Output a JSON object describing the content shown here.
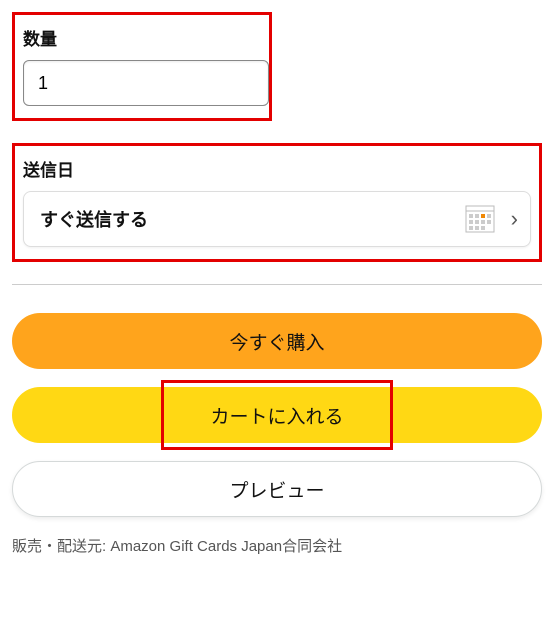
{
  "quantity": {
    "label": "数量",
    "value": "1"
  },
  "sendDate": {
    "label": "送信日",
    "option": "すぐ送信する"
  },
  "buttons": {
    "buyNow": "今すぐ購入",
    "addToCart": "カートに入れる",
    "preview": "プレビュー"
  },
  "seller": "販売・配送元: Amazon Gift Cards Japan合同会社"
}
